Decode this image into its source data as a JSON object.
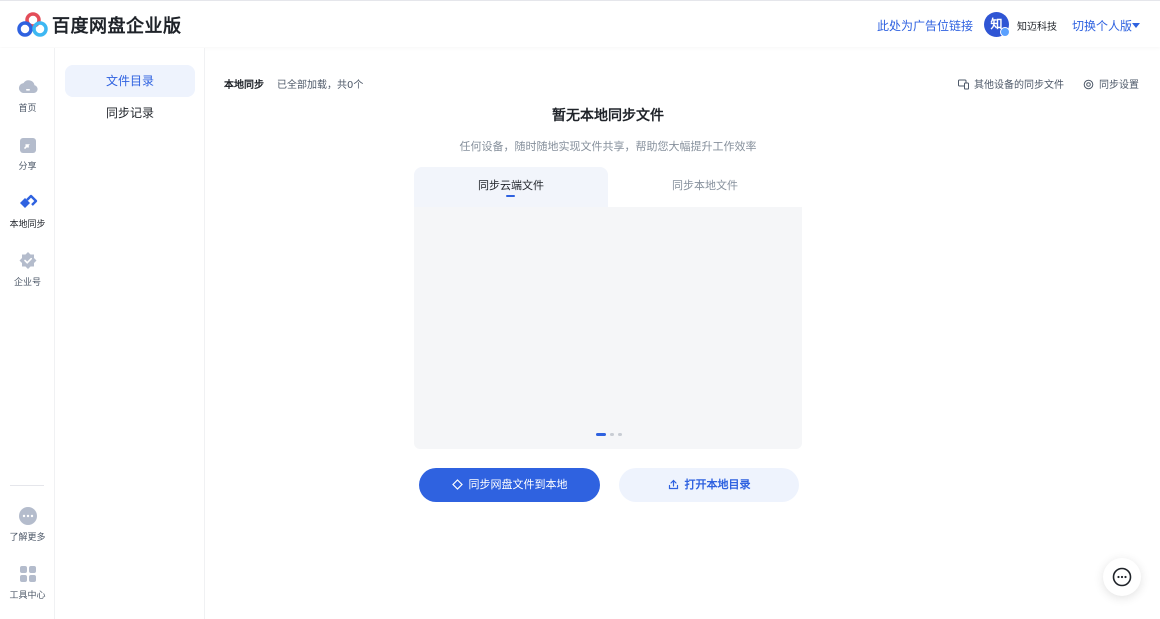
{
  "header": {
    "brand": "百度网盘企业版",
    "ad_link": "此处为广告位链接",
    "avatar_text": "知",
    "company": "知迈科技",
    "switch_label": "切换个人版"
  },
  "rail": {
    "items": [
      {
        "label": "首页",
        "icon": "cloud-icon"
      },
      {
        "label": "分享",
        "icon": "share-icon"
      },
      {
        "label": "本地同步",
        "icon": "sync-icon"
      },
      {
        "label": "企业号",
        "icon": "enterprise-icon"
      }
    ],
    "bottom": [
      {
        "label": "了解更多",
        "icon": "more-icon"
      },
      {
        "label": "工具中心",
        "icon": "tools-icon"
      }
    ],
    "colors": {
      "active": "#2f62e0",
      "inactive": "#b4bccc"
    }
  },
  "subnav": {
    "items": [
      {
        "label": "文件目录",
        "active": true
      },
      {
        "label": "同步记录",
        "active": false
      }
    ]
  },
  "main": {
    "section_title": "本地同步",
    "status": "已全部加载，共0个",
    "other_devices": "其他设备的同步文件",
    "sync_settings": "同步设置",
    "empty_title": "暂无本地同步文件",
    "empty_subtitle": "任何设备，随时随地实现文件共享，帮助您大幅提升工作效率",
    "tabs": [
      {
        "label": "同步云端文件",
        "active": true
      },
      {
        "label": "同步本地文件",
        "active": false
      }
    ],
    "carousel": {
      "total": 3,
      "current": 1
    },
    "primary_button": "同步网盘文件到本地",
    "secondary_button": "打开本地目录"
  },
  "colors": {
    "accent": "#2f62e0",
    "panel_bg": "#f5f6f8"
  }
}
